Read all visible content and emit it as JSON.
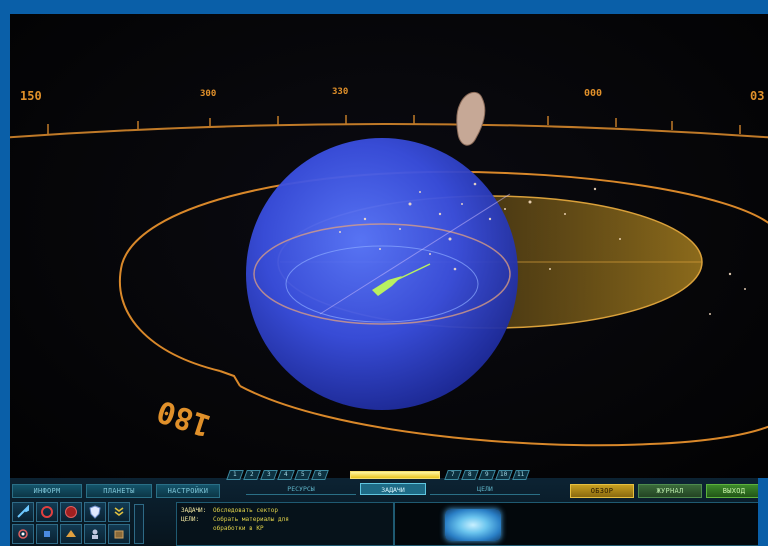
{
  "scene": {
    "compass_labels": [
      {
        "text": "150",
        "name": "compass-label-150"
      },
      {
        "text": "300",
        "name": "compass-label-300"
      },
      {
        "text": "330",
        "name": "compass-label-330"
      },
      {
        "text": "000",
        "name": "compass-label-000"
      },
      {
        "text": "03",
        "name": "compass-label-03"
      }
    ],
    "bearing_label": "180",
    "colors": {
      "orbit_ring": "#d9882a",
      "planet": "#3c54e8",
      "sector": "#b58a20"
    }
  },
  "hud": {
    "left_tabs": [
      "ИНФОРМ",
      "ПЛАНЕТЫ",
      "НАСТРОЙКИ"
    ],
    "mid_tabs": [
      {
        "label": "РЕСУРСЫ",
        "active": false
      },
      {
        "label": "ЗАДАЧИ",
        "active": true
      },
      {
        "label": "ЦЕЛИ",
        "active": false
      }
    ],
    "right_tabs": [
      {
        "label": "ОБЗОР",
        "state": "active"
      },
      {
        "label": "ЖУРНАЛ",
        "state": "normal"
      },
      {
        "label": "ВЫХОД",
        "state": "green"
      }
    ],
    "number_tabs_left": [
      "1",
      "2",
      "3",
      "4",
      "5",
      "6"
    ],
    "number_tabs_right": [
      "7",
      "8",
      "9",
      "10",
      "11"
    ],
    "icons": [
      {
        "name": "wrench-icon"
      },
      {
        "name": "target-ring-icon"
      },
      {
        "name": "red-sphere-icon"
      },
      {
        "name": "shield-icon"
      },
      {
        "name": "chevron-rank-icon"
      },
      {
        "name": "satellite-icon"
      },
      {
        "name": "probe-icon"
      },
      {
        "name": "fleet-icon"
      },
      {
        "name": "crew-icon"
      },
      {
        "name": "cargo-icon"
      }
    ],
    "messages": [
      {
        "key": "ЗАДАЧИ:",
        "value": "Обследовать сектор"
      },
      {
        "key": "ЦЕЛИ:",
        "value": "Собрать материалы для"
      },
      {
        "key": "",
        "value": "обработки в КР"
      }
    ]
  }
}
